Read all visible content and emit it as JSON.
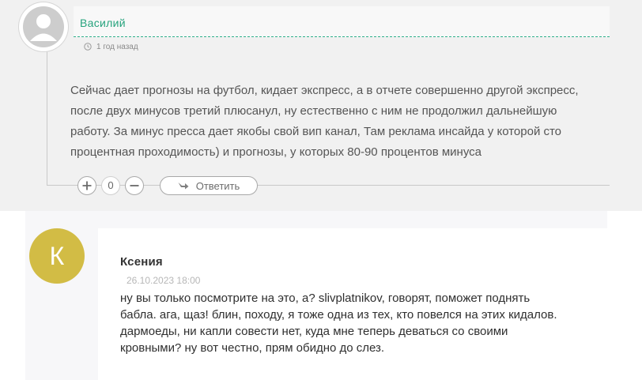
{
  "comments": [
    {
      "author": "Василий",
      "time": "1 год назад",
      "lines": [
        "Сейчас дает прогнозы на футбол, кидает экспресс, а в отчете совершенно другой экспресс,",
        "после двух минусов третий плюсанул, ну естественно с ним не продолжил дальнейшую",
        "работу. За минус пресса дает якобы свой вип канал, Там реклама инсайда у которой сто",
        "процентная проходимость) и прогнозы, у которых 80-90 процентов минуса"
      ],
      "vote_count": "0",
      "reply_label": "Ответить",
      "icons": {
        "avatar": "default-user-avatar",
        "time": "clock-icon",
        "up": "plus-icon",
        "down": "minus-icon",
        "reply": "reply-arrow-icon"
      },
      "colors": {
        "author": "#26a37d",
        "divider": "#2eb08a"
      }
    },
    {
      "author": "Ксения",
      "avatar_letter": "К",
      "date": "26.10.2023 18:00",
      "lines": [
        "ну вы только посмотрите на это, а? slivplatnikov, говорят, поможет поднять",
        "бабла. ага, щаз! блин, походу, я тоже одна из тех, кто повелся на этих кидалов.",
        "дармоеды, ни капли совести нет, куда мне теперь деваться со своими",
        "кровными? ну вот честно, прям обидно до слез."
      ],
      "colors": {
        "avatar": "#d2bc45"
      }
    }
  ]
}
